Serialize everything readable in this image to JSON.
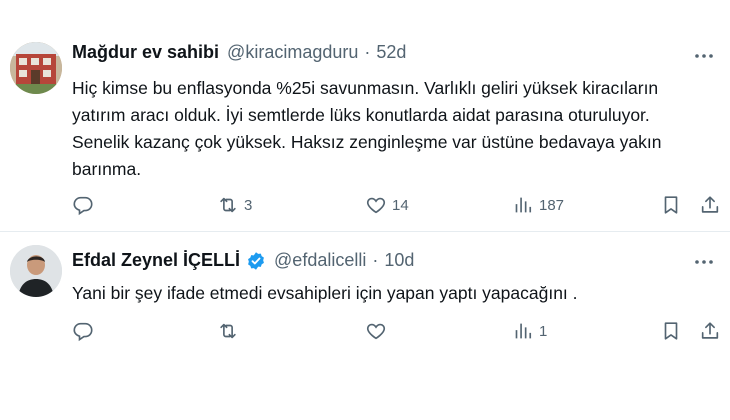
{
  "tweets": [
    {
      "name": "Mağdur ev sahibi",
      "handle": "@kiracimagduru",
      "dot": "·",
      "time": "52d",
      "text": "Hiç kimse bu enflasyonda %25i savunmasın. Varlıklı geliri yüksek kiracıların yatırım aracı olduk. İyi semtlerde lüks konutlarda aidat parasına oturuluyor. Senelik kazanç çok yüksek. Haksız zenginleşme var üstüne bedavaya yakın barınma.",
      "verified": false,
      "replies": "",
      "retweets": "3",
      "likes": "14",
      "views": "187"
    },
    {
      "name": "Efdal Zeynel İÇELLİ",
      "handle": "@efdalicelli",
      "dot": "·",
      "time": "10d",
      "text": "Yani bir şey ifade etmedi evsahipleri için yapan yaptı yapacağını .",
      "verified": true,
      "replies": "",
      "retweets": "",
      "likes": "",
      "views": "1"
    }
  ],
  "icons": {
    "reply": "reply-icon",
    "retweet": "retweet-icon",
    "like": "heart-icon",
    "views": "analytics-icon",
    "bookmark": "bookmark-icon",
    "share": "share-icon",
    "more": "more-icon",
    "verified": "verified-badge-icon"
  },
  "colors": {
    "text": "#0f1419",
    "secondary": "#536471",
    "verified": "#1d9bf0",
    "divider": "#e6ecf0"
  }
}
